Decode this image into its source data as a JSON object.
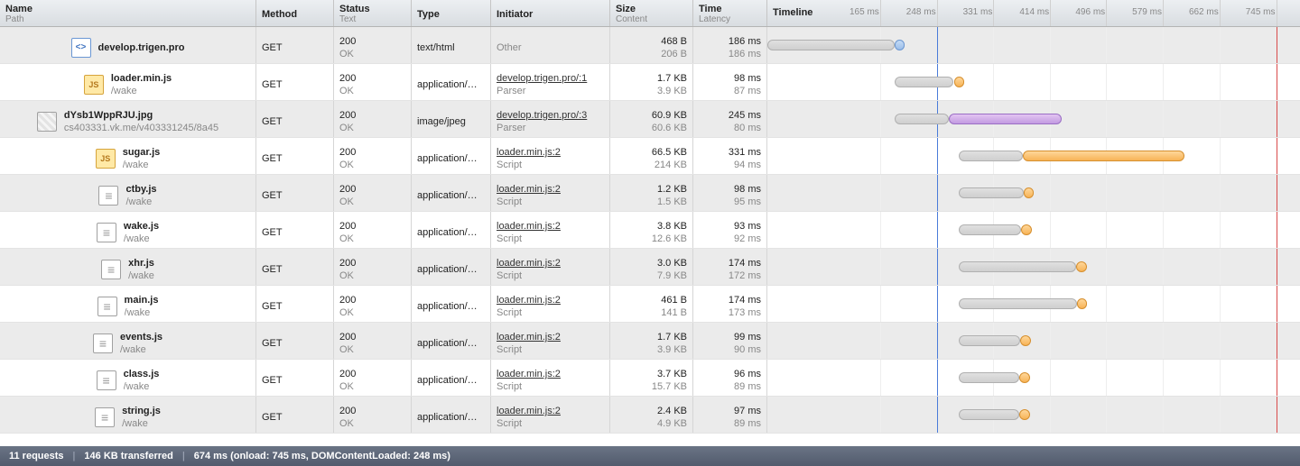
{
  "columns": {
    "name": {
      "main": "Name",
      "sub": "Path"
    },
    "method": {
      "main": "Method"
    },
    "status": {
      "main": "Status",
      "sub": "Text"
    },
    "type": {
      "main": "Type"
    },
    "init": {
      "main": "Initiator"
    },
    "size": {
      "main": "Size",
      "sub": "Content"
    },
    "time": {
      "main": "Time",
      "sub": "Latency"
    },
    "timeline": {
      "main": "Timeline"
    }
  },
  "timeline": {
    "max_ms": 780,
    "ticks_ms": [
      165,
      248,
      331,
      414,
      496,
      579,
      662,
      745
    ],
    "dom_content_loaded_ms": 248,
    "onload_ms": 745
  },
  "rows": [
    {
      "icon": "html",
      "name": "develop.trigen.pro",
      "path": "",
      "method": "GET",
      "status": "200",
      "status_text": "OK",
      "type": "text/html",
      "initiator": "Other",
      "initiator_sub": "",
      "initiator_link": false,
      "size": "468 B",
      "content": "206 B",
      "time": "186 ms",
      "latency": "186 ms",
      "bar": {
        "start": 0,
        "latency": 186,
        "total": 186,
        "kind": "html"
      }
    },
    {
      "icon": "js",
      "name": "loader.min.js",
      "path": "/wake",
      "method": "GET",
      "status": "200",
      "status_text": "OK",
      "type": "application/…",
      "initiator": "develop.trigen.pro/:1",
      "initiator_sub": "Parser",
      "initiator_link": true,
      "size": "1.7 KB",
      "content": "3.9 KB",
      "time": "98 ms",
      "latency": "87 ms",
      "bar": {
        "start": 186,
        "latency": 87,
        "total": 98,
        "kind": "js"
      }
    },
    {
      "icon": "img",
      "name": "dYsb1WppRJU.jpg",
      "path": "cs403331.vk.me/v403331245/8a45",
      "method": "GET",
      "status": "200",
      "status_text": "OK",
      "type": "image/jpeg",
      "initiator": "develop.trigen.pro/:3",
      "initiator_sub": "Parser",
      "initiator_link": true,
      "size": "60.9 KB",
      "content": "60.6 KB",
      "time": "245 ms",
      "latency": "80 ms",
      "bar": {
        "start": 186,
        "latency": 80,
        "total": 245,
        "kind": "img"
      }
    },
    {
      "icon": "js",
      "name": "sugar.js",
      "path": "/wake",
      "method": "GET",
      "status": "200",
      "status_text": "OK",
      "type": "application/…",
      "initiator": "loader.min.js:2",
      "initiator_sub": "Script",
      "initiator_link": true,
      "size": "66.5 KB",
      "content": "214 KB",
      "time": "331 ms",
      "latency": "94 ms",
      "bar": {
        "start": 280,
        "latency": 94,
        "total": 331,
        "kind": "js"
      }
    },
    {
      "icon": "txt",
      "name": "ctby.js",
      "path": "/wake",
      "method": "GET",
      "status": "200",
      "status_text": "OK",
      "type": "application/…",
      "initiator": "loader.min.js:2",
      "initiator_sub": "Script",
      "initiator_link": true,
      "size": "1.2 KB",
      "content": "1.5 KB",
      "time": "98 ms",
      "latency": "95 ms",
      "bar": {
        "start": 280,
        "latency": 95,
        "total": 98,
        "kind": "js"
      }
    },
    {
      "icon": "txt",
      "name": "wake.js",
      "path": "/wake",
      "method": "GET",
      "status": "200",
      "status_text": "OK",
      "type": "application/…",
      "initiator": "loader.min.js:2",
      "initiator_sub": "Script",
      "initiator_link": true,
      "size": "3.8 KB",
      "content": "12.6 KB",
      "time": "93 ms",
      "latency": "92 ms",
      "bar": {
        "start": 280,
        "latency": 92,
        "total": 93,
        "kind": "js"
      }
    },
    {
      "icon": "txt",
      "name": "xhr.js",
      "path": "/wake",
      "method": "GET",
      "status": "200",
      "status_text": "OK",
      "type": "application/…",
      "initiator": "loader.min.js:2",
      "initiator_sub": "Script",
      "initiator_link": true,
      "size": "3.0 KB",
      "content": "7.9 KB",
      "time": "174 ms",
      "latency": "172 ms",
      "bar": {
        "start": 280,
        "latency": 172,
        "total": 174,
        "kind": "js"
      }
    },
    {
      "icon": "txt",
      "name": "main.js",
      "path": "/wake",
      "method": "GET",
      "status": "200",
      "status_text": "OK",
      "type": "application/…",
      "initiator": "loader.min.js:2",
      "initiator_sub": "Script",
      "initiator_link": true,
      "size": "461 B",
      "content": "141 B",
      "time": "174 ms",
      "latency": "173 ms",
      "bar": {
        "start": 280,
        "latency": 173,
        "total": 174,
        "kind": "js"
      }
    },
    {
      "icon": "txt",
      "name": "events.js",
      "path": "/wake",
      "method": "GET",
      "status": "200",
      "status_text": "OK",
      "type": "application/…",
      "initiator": "loader.min.js:2",
      "initiator_sub": "Script",
      "initiator_link": true,
      "size": "1.7 KB",
      "content": "3.9 KB",
      "time": "99 ms",
      "latency": "90 ms",
      "bar": {
        "start": 280,
        "latency": 90,
        "total": 99,
        "kind": "js"
      }
    },
    {
      "icon": "txt",
      "name": "class.js",
      "path": "/wake",
      "method": "GET",
      "status": "200",
      "status_text": "OK",
      "type": "application/…",
      "initiator": "loader.min.js:2",
      "initiator_sub": "Script",
      "initiator_link": true,
      "size": "3.7 KB",
      "content": "15.7 KB",
      "time": "96 ms",
      "latency": "89 ms",
      "bar": {
        "start": 280,
        "latency": 89,
        "total": 96,
        "kind": "js"
      }
    },
    {
      "icon": "txt",
      "name": "string.js",
      "path": "/wake",
      "method": "GET",
      "status": "200",
      "status_text": "OK",
      "type": "application/…",
      "initiator": "loader.min.js:2",
      "initiator_sub": "Script",
      "initiator_link": true,
      "size": "2.4 KB",
      "content": "4.9 KB",
      "time": "97 ms",
      "latency": "89 ms",
      "bar": {
        "start": 280,
        "latency": 89,
        "total": 97,
        "kind": "js"
      }
    }
  ],
  "footer": {
    "requests": "11 requests",
    "transferred": "146 KB transferred",
    "timing": "674 ms (onload: 745 ms, DOMContentLoaded: 248 ms)"
  }
}
